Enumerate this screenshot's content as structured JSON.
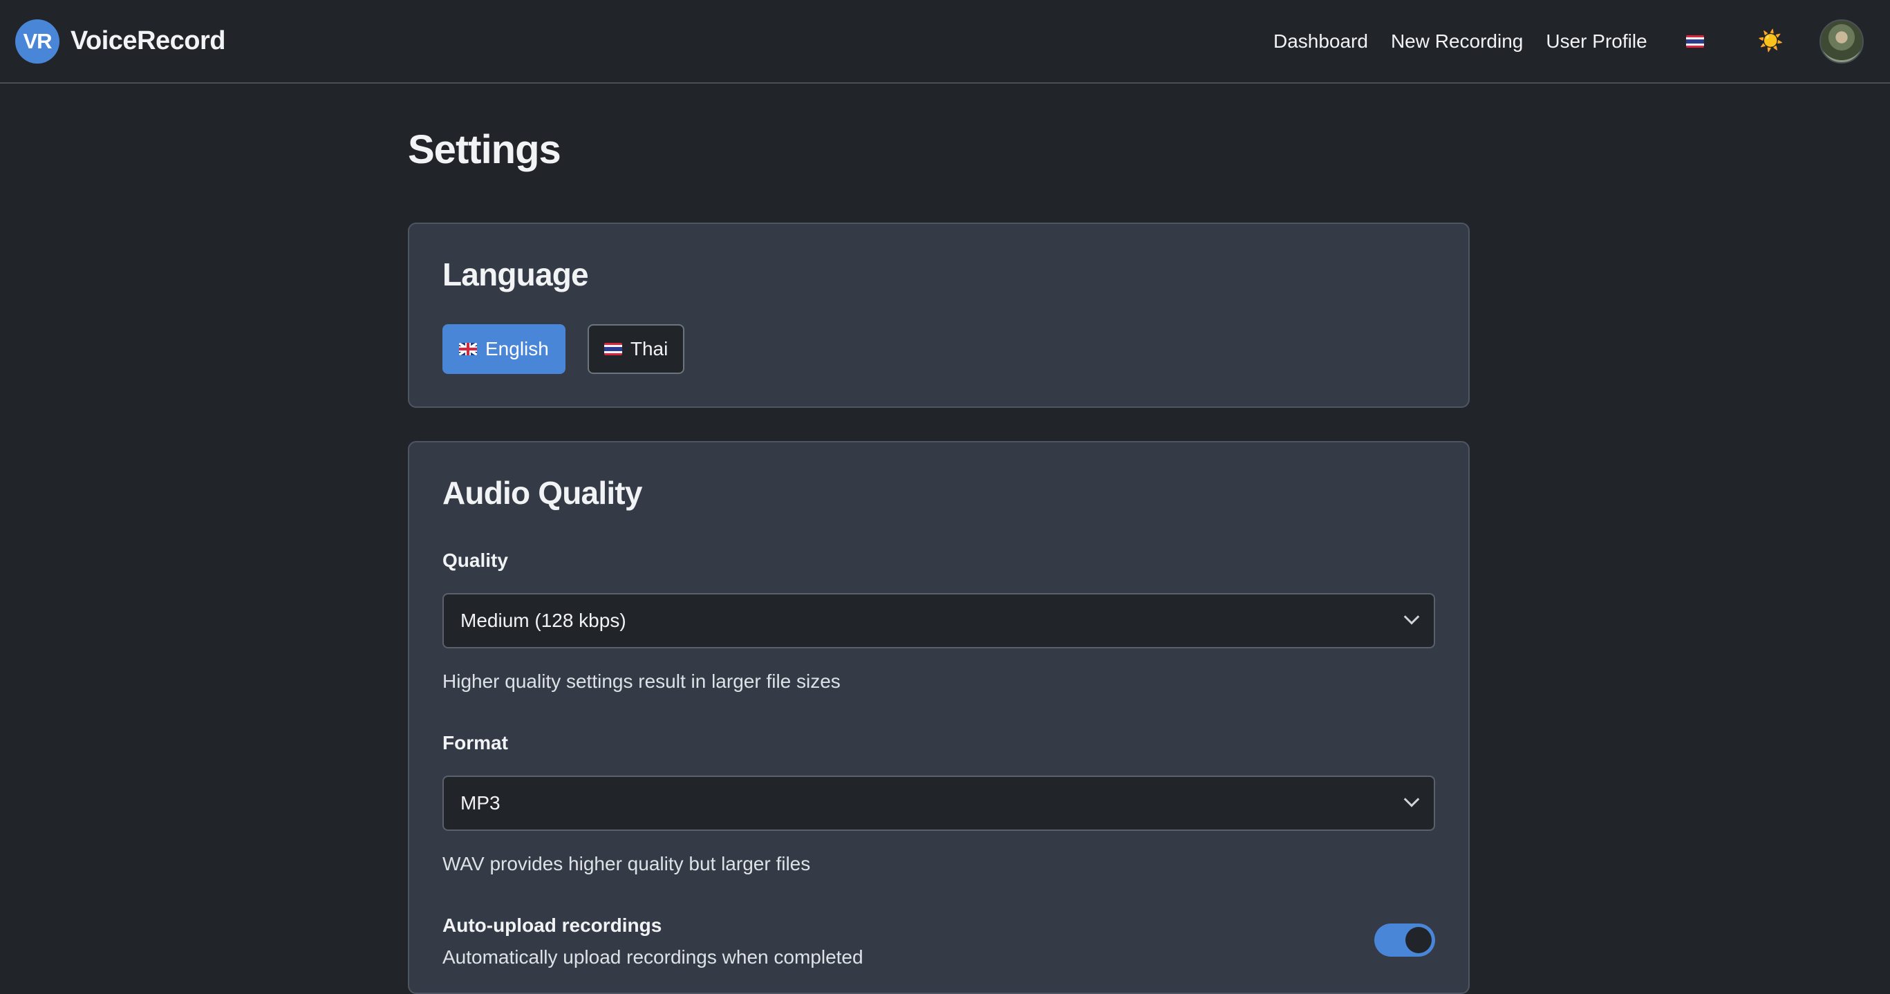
{
  "navbar": {
    "brand_badge": "VR",
    "brand_name": "VoiceRecord",
    "links": [
      "Dashboard",
      "New Recording",
      "User Profile"
    ],
    "language_icon": "thai-flag-icon",
    "theme_icon": "sun-icon",
    "theme_glyph": "☀️"
  },
  "page": {
    "title": "Settings"
  },
  "language_card": {
    "title": "Language",
    "options": [
      {
        "label": "English",
        "icon": "uk-flag-icon",
        "selected": true
      },
      {
        "label": "Thai",
        "icon": "thai-flag-icon",
        "selected": false
      }
    ]
  },
  "audio_card": {
    "title": "Audio Quality",
    "quality": {
      "label": "Quality",
      "value": "Medium (128 kbps)",
      "help": "Higher quality settings result in larger file sizes"
    },
    "format": {
      "label": "Format",
      "value": "MP3",
      "help": "WAV provides higher quality but larger files"
    },
    "auto_upload": {
      "label": "Auto-upload recordings",
      "description": "Automatically upload recordings when completed",
      "enabled": true
    }
  },
  "colors": {
    "accent": "#4a86d8",
    "background": "#212529",
    "card": "#343a46"
  }
}
